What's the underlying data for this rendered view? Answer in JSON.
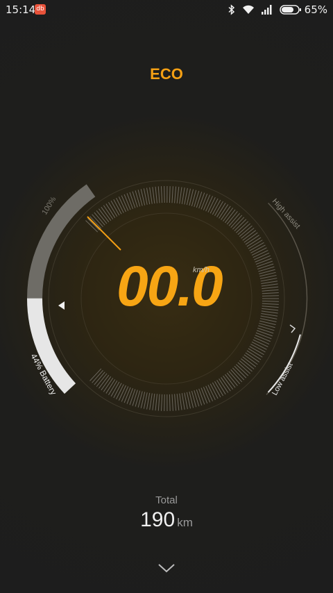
{
  "status_bar": {
    "time": "15:14",
    "app_badge": "db",
    "battery_percent": "65%",
    "icons": [
      "bluetooth-icon",
      "wifi-icon",
      "signal-icon",
      "battery-icon"
    ]
  },
  "mode": {
    "label": "ECO"
  },
  "speedometer": {
    "speed": "00.0",
    "unit": "km/h",
    "battery_label": "44% Battery",
    "battery_level": 0.44,
    "battery_max_label": "100%",
    "high_assist_label": "High assist",
    "low_assist_label": "Low assist"
  },
  "total": {
    "label": "Total",
    "value": "190",
    "unit": "km"
  },
  "colors": {
    "accent": "#f5a014",
    "battery_fill": "#e6e6e6",
    "battery_empty": "#6e6c66"
  },
  "footer": {
    "expand_icon": "chevron-down-icon"
  }
}
